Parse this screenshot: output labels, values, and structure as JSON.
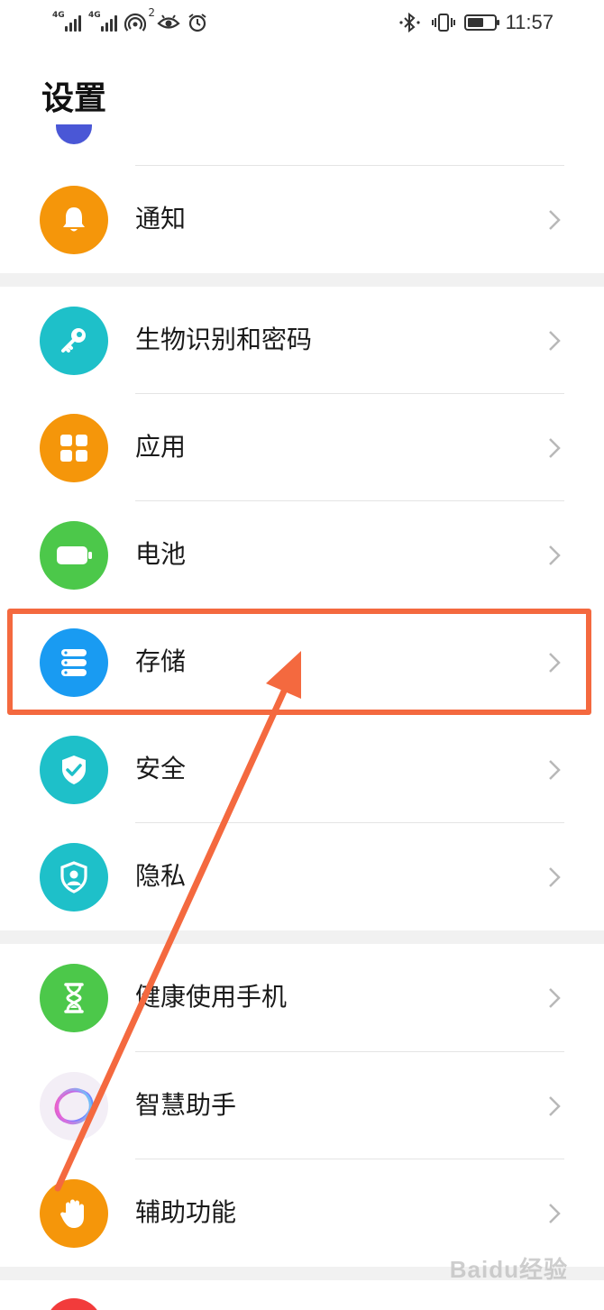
{
  "status_bar": {
    "signal1_tag": "4G",
    "signal2_tag": "4G",
    "hotspot_count": "2",
    "time": "11:57"
  },
  "header": {
    "title": "设置"
  },
  "settings": [
    {
      "label": "通知",
      "icon": "bell-icon",
      "color": "#f5960a"
    },
    {
      "label": "生物识别和密码",
      "icon": "key-icon",
      "color": "#1ec0c9"
    },
    {
      "label": "应用",
      "icon": "apps-grid-icon",
      "color": "#f5960a"
    },
    {
      "label": "电池",
      "icon": "battery-icon",
      "color": "#4cc84a"
    },
    {
      "label": "存储",
      "icon": "storage-icon",
      "color": "#199bf2"
    },
    {
      "label": "安全",
      "icon": "shield-check-icon",
      "color": "#1ec0c9"
    },
    {
      "label": "隐私",
      "icon": "privacy-shield-icon",
      "color": "#1ec0c9"
    },
    {
      "label": "健康使用手机",
      "icon": "hourglass-icon",
      "color": "#4cc84a"
    },
    {
      "label": "智慧助手",
      "icon": "assistant-orb-icon",
      "color": "#f3eef6"
    },
    {
      "label": "辅助功能",
      "icon": "hand-icon",
      "color": "#f5960a"
    }
  ],
  "watermark": "Baidu经验",
  "accent_color": "#f4693f"
}
